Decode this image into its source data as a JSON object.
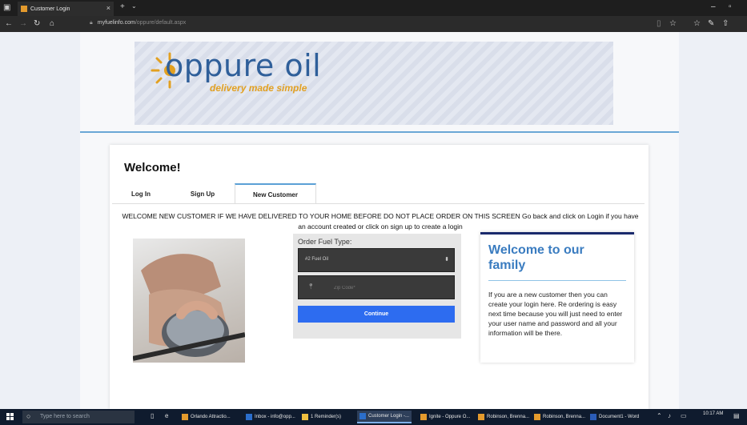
{
  "browser": {
    "tab_title": "Customer Login",
    "tab_close": "×",
    "new_tab": "+",
    "tab_dropdown": "⌄",
    "url_domain": "myfuelinfo.com",
    "url_path": "/oppure/default.aspx",
    "win_minimize": "–",
    "win_restore": "▫"
  },
  "brand": {
    "name": "oppure oil",
    "tagline": "delivery made simple",
    "colors": {
      "blue": "#2f5f9a",
      "orange": "#e2a021"
    }
  },
  "page": {
    "heading": "Welcome!",
    "tabs": [
      "Log In",
      "Sign Up",
      "New Customer"
    ],
    "active_tab": "New Customer",
    "notice": "WELCOME NEW CUSTOMER IF WE HAVE DELIVERED TO YOUR HOME BEFORE DO NOT PLACE ORDER ON THIS SCREEN Go back and click on Login if you have an account created or click on sign up to create a login"
  },
  "form": {
    "label": "Order Fuel Type:",
    "fuel_type_value": "#2 Fuel Oil",
    "zip_placeholder": "Zip Code*",
    "continue_label": "Continue",
    "accent_color": "#2d6cf0"
  },
  "sidebar": {
    "title": "Welcome to our family",
    "body": "If you are a new customer then you can create your login here. Re ordering is easy next time because you will just need to enter your user name and password and all your information will be there."
  },
  "taskbar": {
    "search_placeholder": "Type here to search",
    "items": [
      "Orlando Attractio...",
      "Inbox - info@opp...",
      "1 Reminder(s)",
      "Customer Login -...",
      "Ignite - Oppure O...",
      "Robinson, Brenna...",
      "Robinson, Brenna...",
      "Document1 - Word"
    ],
    "time": "10:17 AM"
  }
}
